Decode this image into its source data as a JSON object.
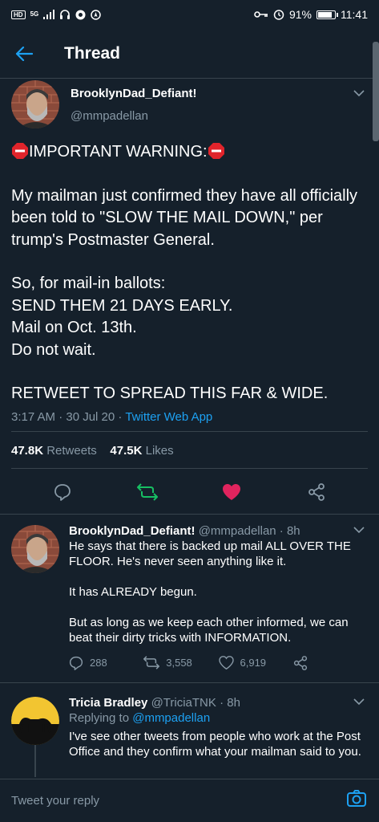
{
  "status_bar": {
    "hd": "HD",
    "network": "5G",
    "battery": "91%",
    "battery_level": 0.91,
    "time": "11:41"
  },
  "header": {
    "title": "Thread"
  },
  "main_tweet": {
    "display_name": "BrooklynDad_Defiant!",
    "handle": "@mmpadellan",
    "warning": "IMPORTANT WARNING:",
    "paragraph1": "My mailman just confirmed they have all officially been told to \"SLOW THE MAIL DOWN,\" per trump's Postmaster General.",
    "line1": "So, for mail-in ballots:",
    "line2": "SEND THEM 21 DAYS EARLY.",
    "line3": "Mail on Oct. 13th.",
    "line4": "Do not wait.",
    "closing": "RETWEET TO SPREAD THIS FAR & WIDE.",
    "timestamp": "3:17 AM · 30 Jul 20 · ",
    "app": "Twitter Web App",
    "retweets_count": "47.8K",
    "retweets_label": "Retweets",
    "likes_count": "47.5K",
    "likes_label": "Likes"
  },
  "replies": [
    {
      "display_name": "BrooklynDad_Defiant!",
      "meta": "@mmpadellan · 8h",
      "p1": "He says that there is backed up mail ALL OVER THE FLOOR. He's never seen anything like it.",
      "p2": "It has ALREADY begun.",
      "p3": "But as long as we keep each other informed, we can beat their dirty tricks with INFORMATION.",
      "replies": "288",
      "retweets": "3,558",
      "likes": "6,919"
    },
    {
      "display_name": "Tricia Bradley",
      "meta": "@TriciaTNK · 8h",
      "replying_prefix": "Replying to ",
      "replying_to": "@mmpadellan",
      "p1": "I've see other tweets from people who work at the Post Office and they confirm what your mailman said to you."
    }
  ],
  "compose": {
    "placeholder": "Tweet your reply"
  },
  "colors": {
    "background": "#15202b",
    "accent": "#1da1f2",
    "like": "#e0245e",
    "retweet": "#17bf63",
    "muted": "#8899a6"
  }
}
